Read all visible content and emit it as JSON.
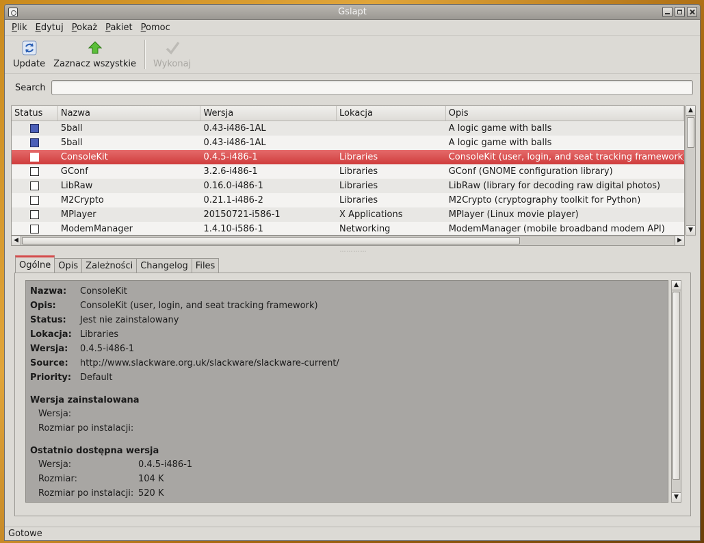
{
  "window": {
    "title": "Gslapt"
  },
  "menu": [
    {
      "label": "Plik",
      "mnemonic": "P",
      "rest": "lik"
    },
    {
      "label": "Edytuj",
      "mnemonic": "E",
      "rest": "dytuj"
    },
    {
      "label": "Pokaż",
      "mnemonic": "P",
      "rest": "okaż"
    },
    {
      "label": "Pakiet",
      "mnemonic": "P",
      "rest": "akiet"
    },
    {
      "label": "Pomoc",
      "mnemonic": "P",
      "rest": "omoc"
    }
  ],
  "toolbar": {
    "update_label": "Update",
    "select_all_label": "Zaznacz wszystkie",
    "execute_label": "Wykonaj"
  },
  "search": {
    "label": "Search",
    "value": ""
  },
  "columns": [
    "Status",
    "Nazwa",
    "Wersja",
    "Lokacja",
    "Opis"
  ],
  "packages": [
    {
      "installed": true,
      "name": "5ball",
      "version": "0.43-i486-1AL",
      "location": "",
      "description": "A logic game with balls",
      "selected": false
    },
    {
      "installed": true,
      "name": "5ball",
      "version": "0.43-i486-1AL",
      "location": "",
      "description": "A logic game with balls",
      "selected": false
    },
    {
      "installed": false,
      "name": "ConsoleKit",
      "version": "0.4.5-i486-1",
      "location": "Libraries",
      "description": "ConsoleKit (user, login, and seat tracking framework)",
      "selected": true
    },
    {
      "installed": false,
      "name": "GConf",
      "version": "3.2.6-i486-1",
      "location": "Libraries",
      "description": "GConf (GNOME configuration library)",
      "selected": false
    },
    {
      "installed": false,
      "name": "LibRaw",
      "version": "0.16.0-i486-1",
      "location": "Libraries",
      "description": "LibRaw (library for decoding raw digital photos)",
      "selected": false
    },
    {
      "installed": false,
      "name": "M2Crypto",
      "version": "0.21.1-i486-2",
      "location": "Libraries",
      "description": "M2Crypto (cryptography toolkit for Python)",
      "selected": false
    },
    {
      "installed": false,
      "name": "MPlayer",
      "version": "20150721-i586-1",
      "location": "X Applications",
      "description": "MPlayer (Linux movie player)",
      "selected": false
    },
    {
      "installed": false,
      "name": "ModemManager",
      "version": "1.4.10-i586-1",
      "location": "Networking",
      "description": "ModemManager (mobile broadband modem API)",
      "selected": false
    }
  ],
  "tabs": [
    {
      "label": "Ogólne",
      "active": true
    },
    {
      "label": "Opis",
      "active": false
    },
    {
      "label": "Zależności",
      "active": false
    },
    {
      "label": "Changelog",
      "active": false
    },
    {
      "label": "Files",
      "active": false
    }
  ],
  "details": {
    "fields": [
      {
        "key": "Nazwa:",
        "value": "ConsoleKit"
      },
      {
        "key": "Opis:",
        "value": "ConsoleKit (user, login, and seat tracking framework)"
      },
      {
        "key": "Status:",
        "value": "Jest nie zainstalowany"
      },
      {
        "key": "Lokacja:",
        "value": "Libraries"
      },
      {
        "key": "Wersja:",
        "value": "0.4.5-i486-1"
      },
      {
        "key": "Source:",
        "value": "http://www.slackware.org.uk/slackware/slackware-current/"
      },
      {
        "key": "Priority:",
        "value": "Default"
      }
    ],
    "installed_heading": "Wersja zainstalowana",
    "installed": [
      {
        "key": "Wersja:",
        "value": ""
      },
      {
        "key": "Rozmiar po instalacji:",
        "value": ""
      }
    ],
    "latest_heading": "Ostatnio dostępna wersja",
    "latest": [
      {
        "key": "Wersja:",
        "value": "0.4.5-i486-1"
      },
      {
        "key": "Rozmiar:",
        "value": "104 K"
      },
      {
        "key": "Rozmiar po instalacji:",
        "value": "520 K"
      }
    ]
  },
  "status": {
    "text": "Gotowe"
  },
  "colors": {
    "selection": "#d44a4a",
    "installed_marker": "#4b5fb8"
  }
}
